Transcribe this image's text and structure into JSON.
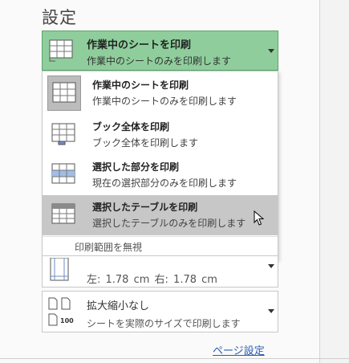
{
  "settings": {
    "title": "設定"
  },
  "selected": {
    "title": "作業中のシートを印刷",
    "subtitle": "作業中のシートのみを印刷します"
  },
  "menu": {
    "items": [
      {
        "title": "作業中のシートを印刷",
        "subtitle": "作業中のシートのみを印刷します",
        "icon": "active-sheet-icon",
        "selected": true
      },
      {
        "title": "ブック全体を印刷",
        "subtitle": "ブック全体を印刷します",
        "icon": "workbook-icon"
      },
      {
        "title": "選択した部分を印刷",
        "subtitle": "現在の選択部分のみを印刷します",
        "icon": "selection-icon"
      },
      {
        "title": "選択したテーブルを印刷",
        "subtitle": "選択したテーブルのみを印刷します",
        "icon": "table-icon",
        "hover": true
      }
    ],
    "clear_print_area": "印刷範囲を無視"
  },
  "margins": {
    "text": "左:  1.78 cm    右:  1.78 cm"
  },
  "scaling": {
    "title": "拡大縮小なし",
    "subtitle": "シートを実際のサイズで印刷します",
    "icon_label": "100"
  },
  "page_setup": {
    "label": "ページ設定"
  },
  "colors": {
    "selected_bg": "#8fce9c",
    "hover_bg": "#c7c7c7",
    "link": "#2a5db0"
  }
}
